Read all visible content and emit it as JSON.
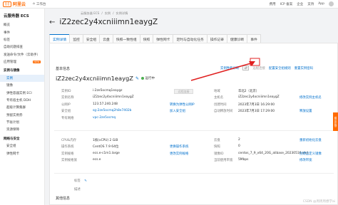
{
  "topbar": {
    "logo": "阿里云",
    "workbench": "工作台",
    "right_items": [
      "费用",
      "ICP 备案",
      "企业",
      "支持",
      "App"
    ]
  },
  "sidebar": {
    "title": "云服务器 ECS",
    "items": [
      {
        "label": "概览",
        "type": "item"
      },
      {
        "label": "事件",
        "type": "item"
      },
      {
        "label": "标签",
        "type": "item"
      },
      {
        "label": "自助问题排查",
        "type": "item"
      },
      {
        "label": "发送命令/文件（云助手）",
        "type": "item"
      },
      {
        "label": "应用管理",
        "type": "item",
        "badge": "NEW"
      },
      {
        "label": "实例与镜像",
        "type": "group"
      },
      {
        "label": "实例",
        "type": "sub",
        "active": true
      },
      {
        "label": "镜像",
        "type": "sub"
      },
      {
        "label": "弹性容器实例 ECI",
        "type": "sub"
      },
      {
        "label": "专有宿主机 DDH",
        "type": "sub"
      },
      {
        "label": "超级计算集群",
        "type": "sub"
      },
      {
        "label": "预留实例券",
        "type": "sub"
      },
      {
        "label": "节省计划",
        "type": "sub"
      },
      {
        "label": "资源保障",
        "type": "sub"
      },
      {
        "label": "网络与安全",
        "type": "group"
      },
      {
        "label": "安全组",
        "type": "sub"
      },
      {
        "label": "弹性网卡",
        "type": "sub"
      }
    ]
  },
  "breadcrumb": [
    "云服务器 ECS",
    "实例",
    "实例详情"
  ],
  "page_title": "iZ2zec2y4xcniiimn1eaygZ",
  "tabs": [
    "实例详情",
    "监控",
    "安全组",
    "云盘",
    "快照一致性组",
    "快照",
    "弹性网卡",
    "定时与自动化任务",
    "操作记录",
    "健康诊断",
    "事件"
  ],
  "basic_info": {
    "section_title": "基本信息",
    "links": [
      "实例性能诊断",
      "远程连接",
      "配置安全组规则",
      "重置实例密码"
    ],
    "instance_name": "iZ2zec2y4xcniiimn1eaygZ",
    "status": "运行中",
    "gray_button": "远程连接",
    "left_rows": [
      {
        "label": "实例ID",
        "value": "i-2ze5ocmq1eaygz"
      },
      {
        "label": "实例名称",
        "value": "iZ2zec2y4xcniiimn1eaygZ"
      },
      {
        "label": "公网IP",
        "value": "123.57.240.248",
        "link": "转换为弹性公网IP"
      },
      {
        "label": "安全组",
        "value": "sg-2ze5ocmq2h8e7402b",
        "link": "加入安全组"
      },
      {
        "label": "专有网络",
        "value": "vpc-2ze5ocmq"
      }
    ],
    "right_rows": [
      {
        "label": "地域",
        "value": "华北2（北京）"
      },
      {
        "label": "主机名",
        "value": "iZ2zec2y4xcniiimn1eaygZ",
        "link": "修改实例主机名"
      },
      {
        "label": "创建时间",
        "value": "2023年7月3日 16:29:00"
      },
      {
        "label": "自动释放时间",
        "value": "2023年7月3日 17:29:00",
        "link": "释放设置"
      }
    ]
  },
  "config_info": {
    "left_rows": [
      {
        "label": "CPU&内存",
        "value": "1核(vCPU) 2 GiB"
      },
      {
        "label": "操作系统",
        "value": "CentOS 7.9 64位",
        "link": "更换操作系统"
      },
      {
        "label": "实例规格",
        "value": "ecs.e-c1m1.large",
        "link": "更改实例规格"
      },
      {
        "label": "实例规格族",
        "value": "ecs.e"
      }
    ],
    "right_rows": [
      {
        "label": "云盘",
        "value": "2",
        "link": "重新初始化云盘"
      },
      {
        "label": "快照",
        "value": "0"
      },
      {
        "label": "镜像ID",
        "value": "centos_7_9_x64_20G_alibase_20230516.vhd",
        "link": "创建自定义镜像"
      },
      {
        "label": "当前使用带宽",
        "value": "5Mbps",
        "link": "修改带宽"
      }
    ]
  },
  "misc": {
    "tag_label": "标签",
    "desc_label": "描述",
    "other_section": "其他信息",
    "watermark": "CSDN @周周周想学ai",
    "help": "建议反馈"
  },
  "colors": {
    "brand": "#ff6a00",
    "link": "#0070cc",
    "arrow": "#e02020"
  }
}
